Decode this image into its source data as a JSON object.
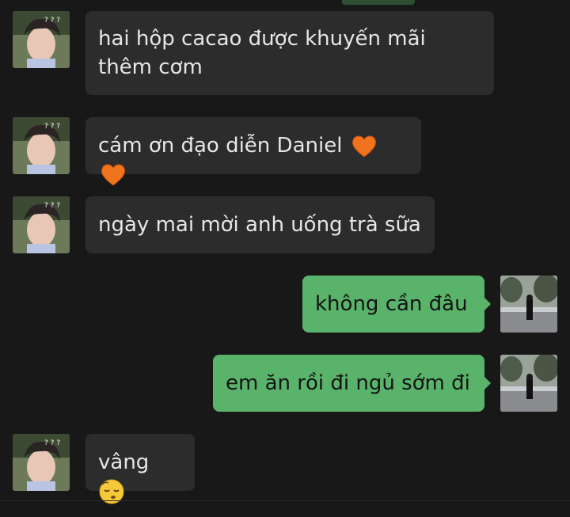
{
  "chat": {
    "messages": [
      {
        "side": "left",
        "text": "hai hộp cacao được khuyến mãi thêm cơm"
      },
      {
        "side": "left",
        "text": "cám ơn đạo diễn Daniel",
        "icons": [
          "heart-icon",
          "heart-icon"
        ]
      },
      {
        "side": "left",
        "text": "ngày mai mời anh uống trà sữa"
      },
      {
        "side": "right",
        "text": "không cần đâu"
      },
      {
        "side": "right",
        "text": "em ăn rồi đi ngủ sớm đi"
      },
      {
        "side": "left",
        "text": "vâng",
        "icons": [
          "sleepy-face-icon"
        ]
      }
    ]
  },
  "colors": {
    "background": "#181818",
    "incoming_bubble": "#2c2c2c",
    "outgoing_bubble": "#5ab36a",
    "incoming_text": "#e6e6e6",
    "outgoing_text": "#141414",
    "heart": "#f0731e"
  }
}
